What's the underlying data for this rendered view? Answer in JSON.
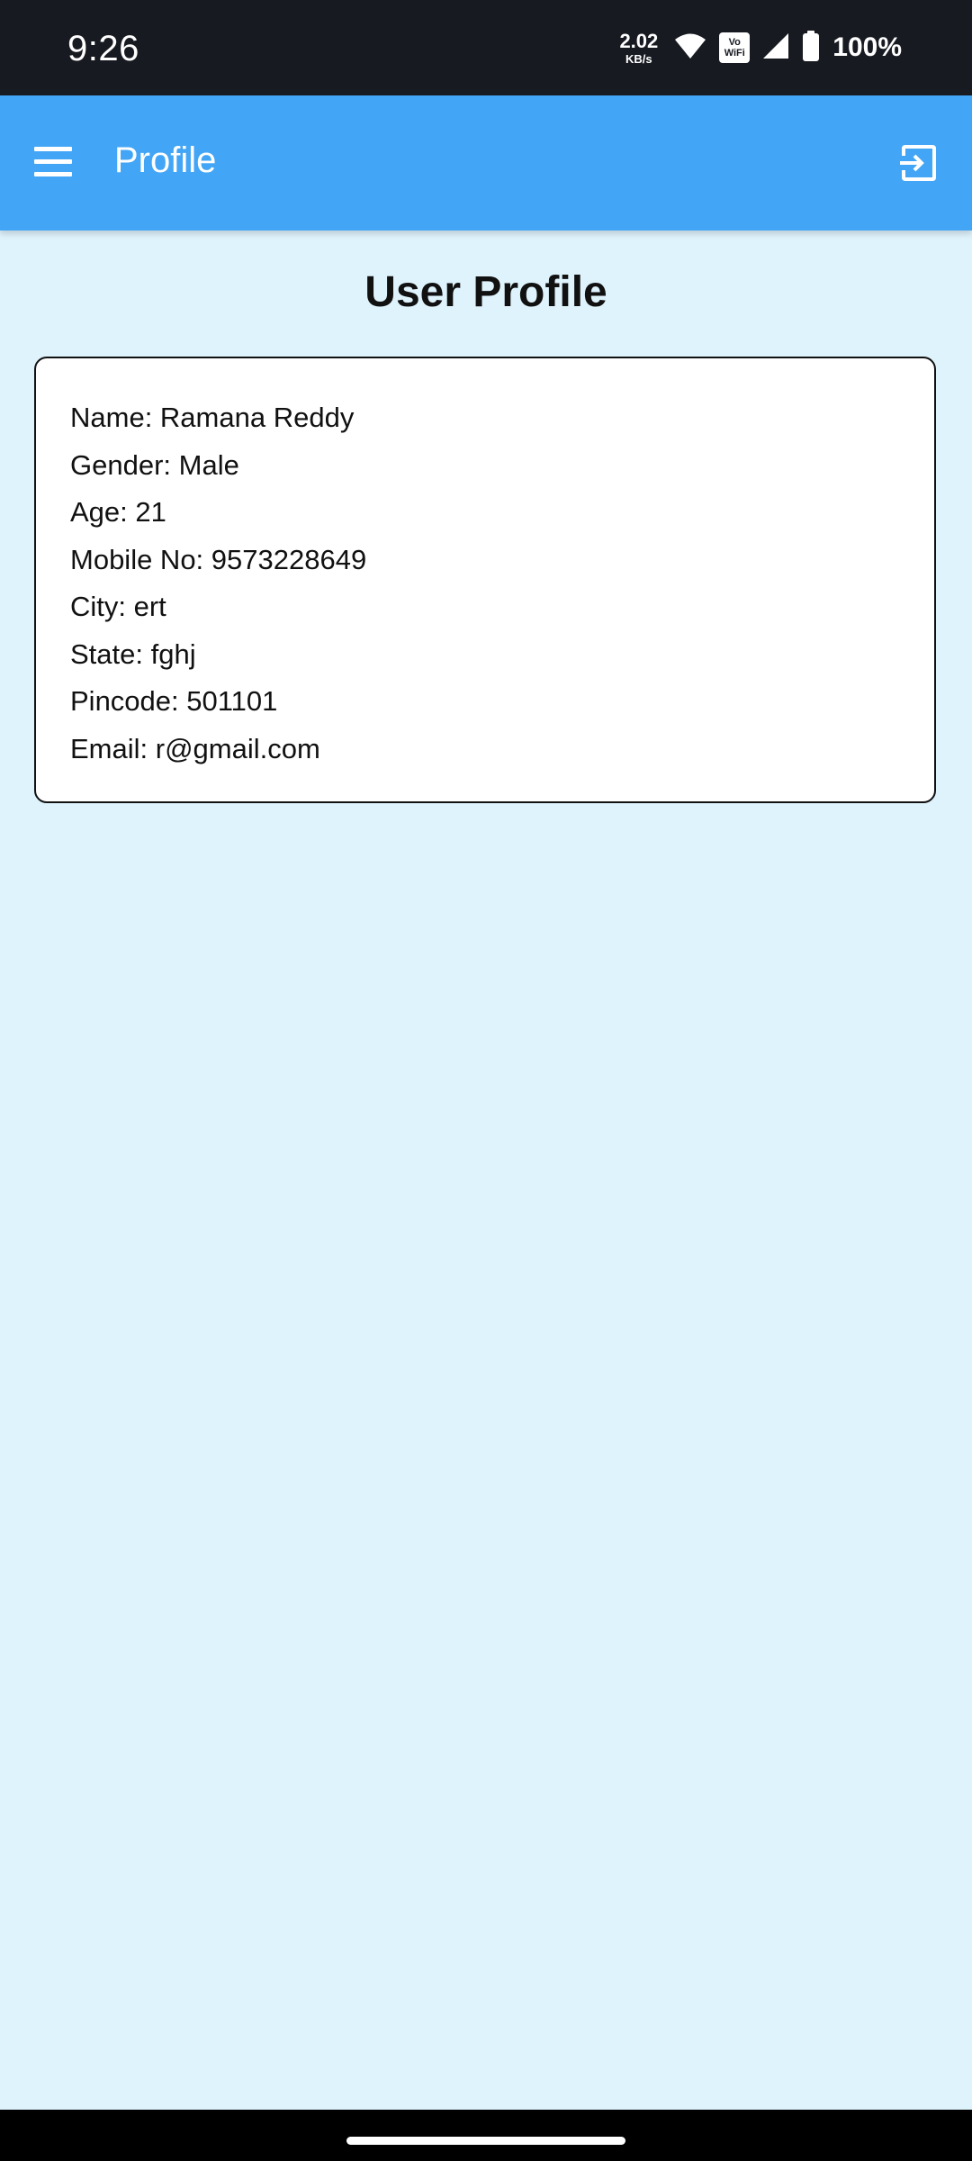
{
  "status_bar": {
    "time": "9:26",
    "net_speed_value": "2.02",
    "net_speed_unit": "KB/s",
    "vowifi_top": "Vo",
    "vowifi_bottom": "WiFi",
    "battery_percent": "100%",
    "icons": [
      "wifi-icon",
      "vowifi-icon",
      "signal-icon",
      "battery-icon"
    ]
  },
  "app_bar": {
    "title": "Profile",
    "background_color": "#42a5f5",
    "menu_icon": "menu-icon",
    "logout_icon": "logout-icon"
  },
  "page": {
    "title": "User Profile",
    "background_color": "#dff3fd"
  },
  "profile": {
    "rows": [
      "Name: Ramana Reddy",
      "Gender: Male",
      "Age: 21",
      "Mobile No: 9573228649",
      "City: ert",
      "State: fghj",
      "Pincode: 501101",
      "Email: r@gmail.com"
    ]
  }
}
